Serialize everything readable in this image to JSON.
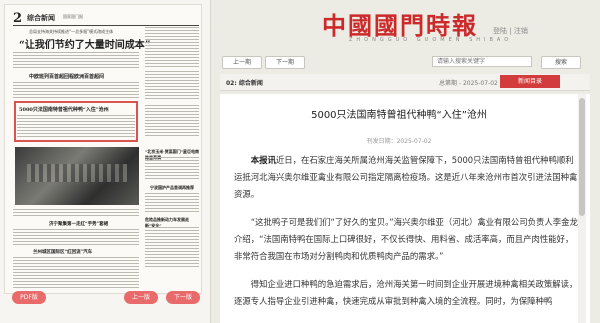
{
  "newspaper_preview": {
    "page_number": "2",
    "section": "综合新闻",
    "publisher_line": "国家国门报",
    "kicker": "总局支持海关持续推进“—总多报”模式改成主体",
    "top_headline": "“让我们节约了大量时间成本”",
    "headlines": [
      "中欧班列百首超回程欧洲百首超间",
      "5000只法国南特曾祖代种鸭“入住”沧州",
      "“北京玉米·贾蕊国门”星巨电商路里荷满",
      "宁波国护产品首调再推荐",
      "济宁聚集第一走红“手势”套裙",
      "危险品推新动力车发展走新“安全”",
      "兰州城区国际区“红回流”汽车"
    ],
    "pdf_button": "PDF版",
    "prev_page_button": "上一版",
    "next_page_button": "下一版"
  },
  "header": {
    "logo_text": "中國國門時報",
    "logo_sub": "ZHONGGUO GUOMEN SHIBAO",
    "login": "登陆",
    "separator": "|",
    "register": "注销"
  },
  "toolbar": {
    "prev_page": "上一期",
    "next_page": "下一期",
    "search_placeholder": "请输入搜索关键字",
    "search_button": "搜索"
  },
  "edition_bar": {
    "edition": "02: 综合新闻",
    "issue": "总第期 - 2025-07-02 编日",
    "toc_button": "新闻目录"
  },
  "article": {
    "title": "5000只法国南特曾祖代种鸭“入住”沧州",
    "date": "刊发日期：2025-07-02",
    "lead_label": "本报讯",
    "lead_text": "近日，在石家庄海关所属沧州海关监管保障下，5000只法国南特曾祖代种鸭顺利运抵河北海兴奥尔维亚禽业有限公司指定隔离检疫场。这是近八年来沧州市首次引进法国种禽资源。",
    "paragraph2": "“这批鸭子可是我们们“了好久的宝贝。”海兴奥尔维亚（河北）禽业有限公司负责人李金龙介绍，“法国南特鸭在国际上口碑很好，不仅长得快、用料省、成活率高，而且产肉性能好，非常符合我国在市场对分割鸭肉和优质鸭肉产品的需求。”",
    "paragraph3": "得知企业进口种鸭的急迫需求后，沧州海关第一时间到企业开展进境种禽相关政策解读，逐源专人指导企业引进种禽，快速完成从审批到种禽入境的全流程。同时，为保障种鸭"
  }
}
